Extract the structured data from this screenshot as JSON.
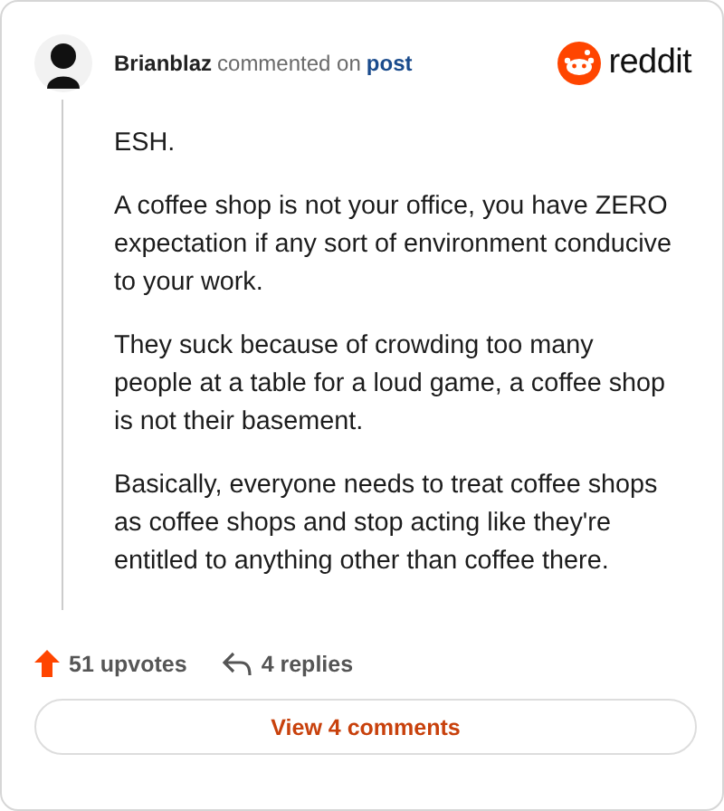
{
  "comment": {
    "author": "Brianblaz",
    "action": "commented on",
    "link": "post"
  },
  "brand": {
    "name": "reddit"
  },
  "paragraphs": [
    "ESH.",
    "A coffee shop is not your office, you have ZERO expectation if any sort of environment conducive to your work.",
    "They suck because of crowding too many people at a table for a loud game, a coffee shop is not their basement.",
    "Basically, everyone needs to treat coffee shops as coffee shops and stop acting like they're entitled to anything other than coffee there."
  ],
  "stats": {
    "upvotes": "51 upvotes",
    "replies": "4 replies"
  },
  "button": "View 4 comments"
}
